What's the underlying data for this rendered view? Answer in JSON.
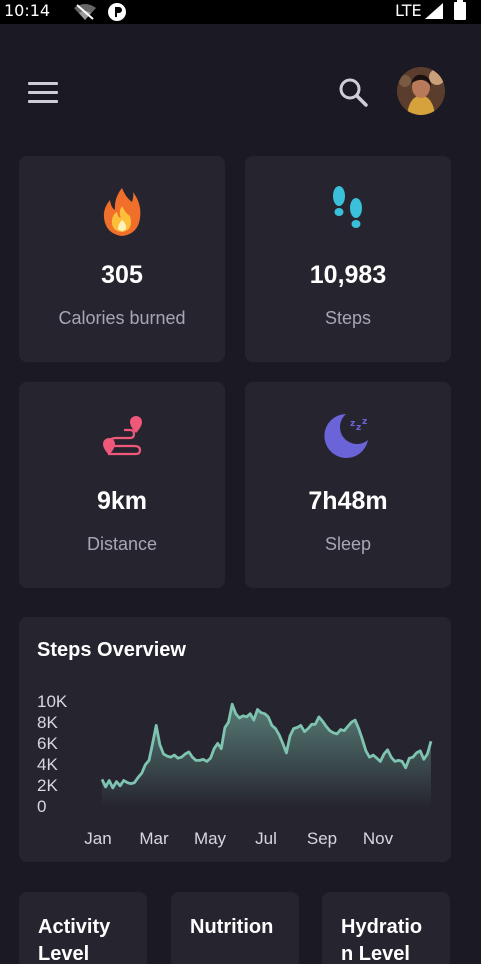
{
  "status_bar": {
    "time": "10:14",
    "network": "LTE",
    "icons": [
      "wifi-off-icon",
      "app-notification-icon",
      "signal-icon",
      "battery-icon"
    ]
  },
  "header": {
    "menu_icon": "menu-icon",
    "search_icon": "search-icon",
    "avatar": "user-avatar"
  },
  "stats": [
    {
      "icon": "fire-icon",
      "value": "305",
      "label": "Calories burned",
      "color": "#f0702b"
    },
    {
      "icon": "footprints-icon",
      "value": "10,983",
      "label": "Steps",
      "color": "#3bc0db"
    },
    {
      "icon": "route-icon",
      "value": "9km",
      "label": "Distance",
      "color": "#f0587a"
    },
    {
      "icon": "moon-icon",
      "value": "7h48m",
      "label": "Sleep",
      "color": "#6a64d8"
    }
  ],
  "chart_data": {
    "type": "area",
    "title": "Steps Overview",
    "y_ticks": [
      "10K",
      "8K",
      "6K",
      "4K",
      "2K",
      "0"
    ],
    "x_ticks": [
      "Jan",
      "Mar",
      "May",
      "Jul",
      "Sep",
      "Nov"
    ],
    "ylim": [
      0,
      10000
    ],
    "line_color": "#7fc3b1",
    "values": [
      2600,
      1900,
      2500,
      1800,
      2400,
      2000,
      2500,
      2300,
      2200,
      2300,
      2800,
      3200,
      4000,
      4400,
      6000,
      7700,
      5900,
      5000,
      4800,
      4700,
      4900,
      4600,
      4700,
      5000,
      5200,
      4700,
      4400,
      4400,
      4500,
      4300,
      4600,
      5500,
      6000,
      5500,
      7500,
      8000,
      9700,
      8800,
      8400,
      8600,
      8500,
      8800,
      8200,
      9200,
      8900,
      8800,
      8500,
      7700,
      7400,
      6800,
      6000,
      5100,
      6700,
      7400,
      7500,
      7700,
      7100,
      7400,
      7800,
      7800,
      8500,
      8100,
      7600,
      7200,
      7000,
      6900,
      7300,
      7200,
      7600,
      8000,
      8200,
      7400,
      6400,
      5300,
      4700,
      4900,
      4600,
      4300,
      5000,
      5400,
      4700,
      4300,
      4400,
      4300,
      3700,
      4600,
      4700,
      5100,
      5300,
      4500,
      5000,
      6200
    ]
  },
  "mini_cards": [
    {
      "label": "Activity Level"
    },
    {
      "label": "Nutrition"
    },
    {
      "label": "Hydration Level"
    }
  ]
}
